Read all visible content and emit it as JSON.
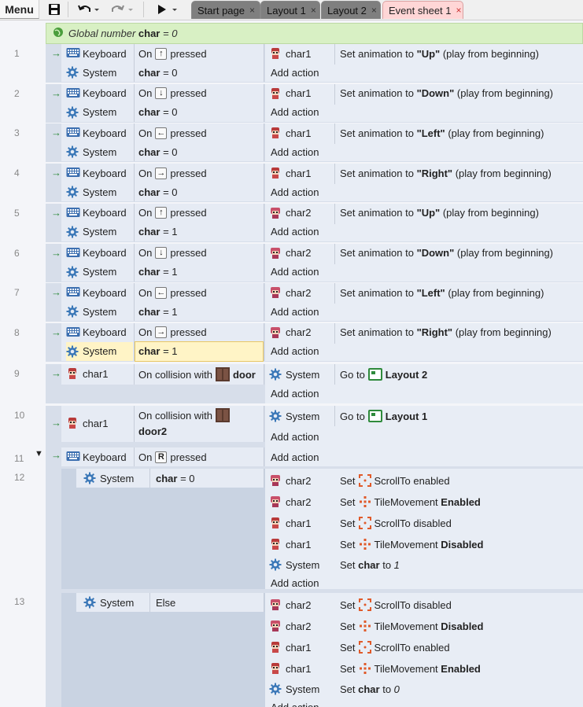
{
  "toolbar": {
    "menu": "Menu",
    "tabs": [
      {
        "label": "Start page",
        "close": "×"
      },
      {
        "label": "Layout 1",
        "close": "×"
      },
      {
        "label": "Layout 2",
        "close": "×"
      },
      {
        "label": "Event sheet 1",
        "close": "×"
      }
    ]
  },
  "global_var": {
    "prefix": "Global number",
    "name": "char",
    "eq": "= 0"
  },
  "labels": {
    "keyboard": "Keyboard",
    "system": "System",
    "add_action": "Add action",
    "on": "On",
    "pressed": "pressed",
    "set_anim": "Set animation to",
    "play_begin": "(play from beginning)",
    "on_collision": "On collision with",
    "goto": "Go to",
    "set": "Set",
    "else": "Else",
    "set_char_to": "Set",
    "char": "char",
    "to": "to"
  },
  "events": [
    {
      "num": "1",
      "key": "↑",
      "obj": "char1",
      "anim": "\"Up\"",
      "cmp": "= 0"
    },
    {
      "num": "2",
      "key": "↓",
      "obj": "char1",
      "anim": "\"Down\"",
      "cmp": "= 0"
    },
    {
      "num": "3",
      "key": "←",
      "obj": "char1",
      "anim": "\"Left\"",
      "cmp": "= 0"
    },
    {
      "num": "4",
      "key": "→",
      "obj": "char1",
      "anim": "\"Right\"",
      "cmp": "= 0"
    },
    {
      "num": "5",
      "key": "↑",
      "obj": "char2",
      "anim": "\"Up\"",
      "cmp": "= 1"
    },
    {
      "num": "6",
      "key": "↓",
      "obj": "char2",
      "anim": "\"Down\"",
      "cmp": "= 1"
    },
    {
      "num": "7",
      "key": "←",
      "obj": "char2",
      "anim": "\"Left\"",
      "cmp": "= 1"
    },
    {
      "num": "8",
      "key": "→",
      "obj": "char2",
      "anim": "\"Right\"",
      "cmp": "= 1"
    }
  ],
  "e9": {
    "num": "9",
    "obj": "char1",
    "target": "door",
    "layout": "Layout 2"
  },
  "e10": {
    "num": "10",
    "obj": "char1",
    "target": "door2",
    "layout": "Layout 1"
  },
  "e11": {
    "num": "11",
    "key": "R"
  },
  "e12": {
    "num": "12",
    "cmp": "= 0",
    "actions": [
      {
        "obj": "char2",
        "beh": "ScrollTo",
        "state": "enabled",
        "bold": false
      },
      {
        "obj": "char2",
        "beh": "TileMovement",
        "state": "Enabled",
        "bold": true
      },
      {
        "obj": "char1",
        "beh": "ScrollTo",
        "state": "disabled",
        "bold": false
      },
      {
        "obj": "char1",
        "beh": "TileMovement",
        "state": "Disabled",
        "bold": true
      }
    ],
    "setval": "1"
  },
  "e13": {
    "num": "13",
    "actions": [
      {
        "obj": "char2",
        "beh": "ScrollTo",
        "state": "disabled",
        "bold": false
      },
      {
        "obj": "char2",
        "beh": "TileMovement",
        "state": "Disabled",
        "bold": true
      },
      {
        "obj": "char1",
        "beh": "ScrollTo",
        "state": "enabled",
        "bold": false
      },
      {
        "obj": "char1",
        "beh": "TileMovement",
        "state": "Enabled",
        "bold": true
      }
    ],
    "setval": "0"
  },
  "colors": {
    "tab_active": "#ffd6d6",
    "global_var_bg": "#d8f0c4",
    "selected": "#fff4c6"
  }
}
